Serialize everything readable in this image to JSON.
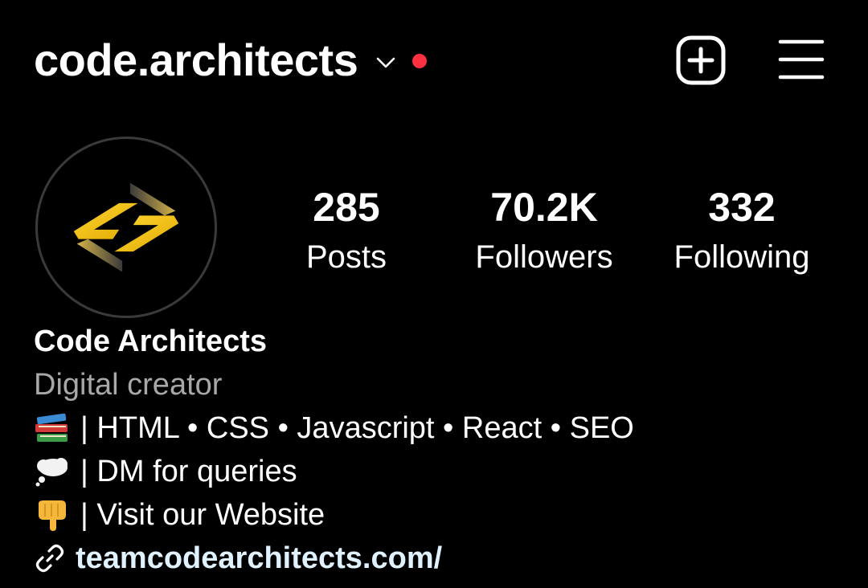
{
  "header": {
    "username": "code.architects",
    "notification_dot_color": "#ff3040",
    "create_icon": "plus-square-icon",
    "menu_icon": "hamburger-menu-icon",
    "dropdown_icon": "chevron-down-icon"
  },
  "profile": {
    "avatar_icon": "code-architects-logo",
    "stats": {
      "posts": {
        "value": "285",
        "label": "Posts"
      },
      "followers": {
        "value": "70.2K",
        "label": "Followers"
      },
      "following": {
        "value": "332",
        "label": "Following"
      }
    }
  },
  "bio": {
    "name": "Code Architects",
    "category": "Digital creator",
    "lines": [
      {
        "icon": "books-emoji-icon",
        "text": "| HTML • CSS • Javascript • React • SEO"
      },
      {
        "icon": "thought-bubble-emoji-icon",
        "text": "| DM for queries"
      },
      {
        "icon": "pointing-down-emoji-icon",
        "text": "| Visit our Website"
      }
    ],
    "link": {
      "icon": "link-icon",
      "text": "teamcodearchitects.com/"
    }
  },
  "colors": {
    "background": "#000000",
    "text": "#ffffff",
    "secondary_text": "#a8a8a8",
    "link": "#e0f1ff",
    "logo_gold": "#f5c518"
  }
}
